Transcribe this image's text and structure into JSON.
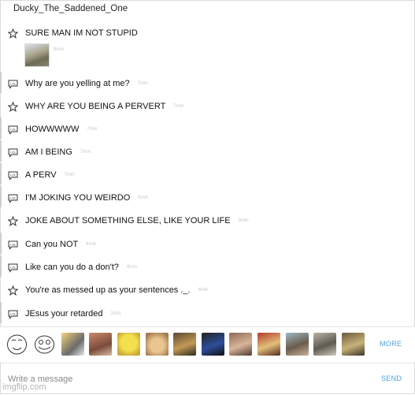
{
  "window": {
    "title": "Ducky_The_Saddened_One"
  },
  "messages": [
    {
      "kind": "star",
      "text": "SURE MAN IM NOT STUPID",
      "time": ""
    },
    {
      "kind": "image",
      "time": "8min"
    },
    {
      "kind": "reply",
      "text": "Why are you yelling at me?",
      "time": "7min"
    },
    {
      "kind": "star",
      "text": "WHY ARE YOU BEING A PERVERT",
      "time": "7min"
    },
    {
      "kind": "reply",
      "text": "HOWWWWW",
      "time": "7min"
    },
    {
      "kind": "reply",
      "text": "AM I BEING",
      "time": "7min"
    },
    {
      "kind": "reply",
      "text": "A PERV",
      "time": "7min"
    },
    {
      "kind": "reply",
      "text": "I'M JOKING YOU WEIRDO",
      "time": "5min"
    },
    {
      "kind": "star",
      "text": "JOKE ABOUT SOMETHING ELSE, LIKE YOUR LIFE",
      "time": "5min"
    },
    {
      "kind": "reply",
      "text": "Can you NOT",
      "time": "4min"
    },
    {
      "kind": "reply",
      "text": "Like can you do a don't?",
      "time": "4min"
    },
    {
      "kind": "star",
      "text": "You're as messed up as your sentences ._.",
      "time": "4min"
    },
    {
      "kind": "reply",
      "text": "JEsus your retarded",
      "time": "2min"
    }
  ],
  "tray": {
    "more_label": "MORE",
    "thumbnails": [
      "rage-face-icon",
      "troll-face-icon",
      "meme-thumb-icon",
      "meme-thumb-icon",
      "spongebob-icon",
      "doge-icon",
      "meme-thumb-icon",
      "meme-thumb-icon",
      "meme-thumb-icon",
      "meme-thumb-icon",
      "meme-thumb-icon",
      "meme-thumb-icon",
      "meme-thumb-icon",
      "meme-thumb-icon"
    ]
  },
  "compose": {
    "placeholder": "Write a message",
    "send_label": "SEND"
  },
  "watermark": "imgflip.com",
  "colors": {
    "accent": "#4aa3df",
    "timestamp": "#c8c8c8",
    "border": "#dcdcdc"
  }
}
